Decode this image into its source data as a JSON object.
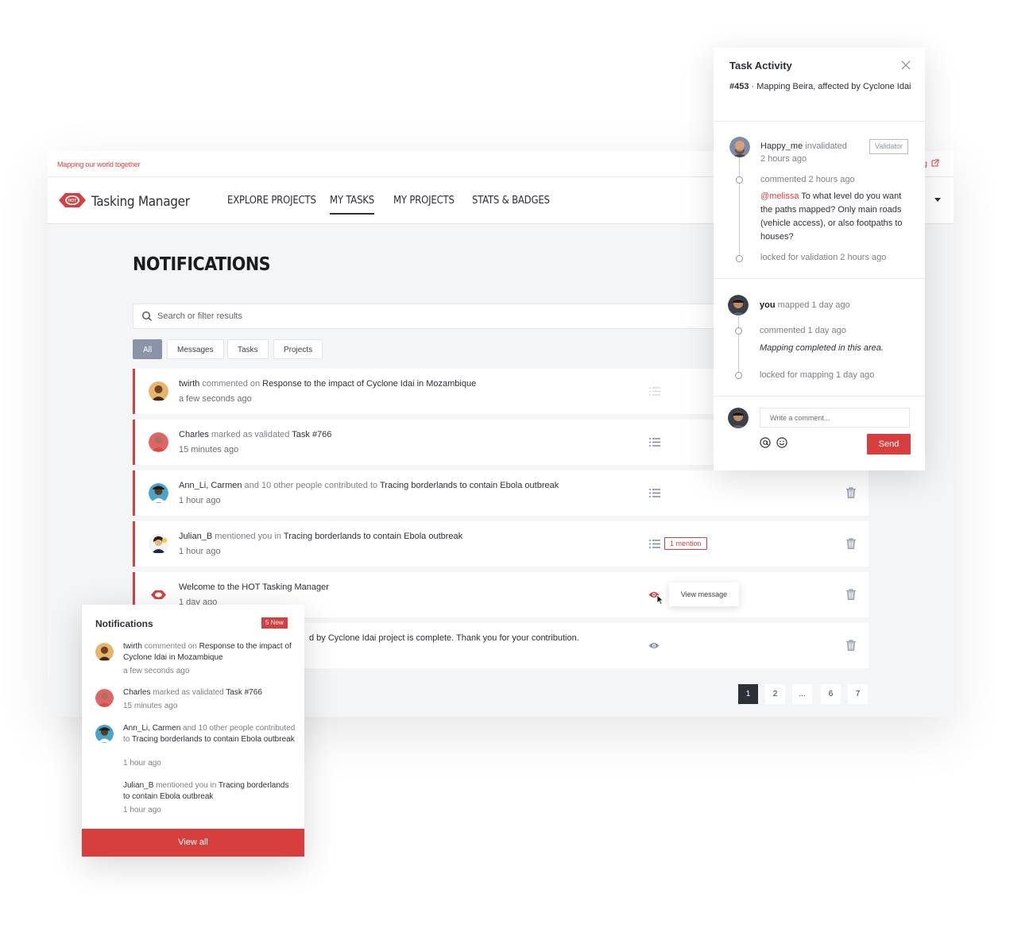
{
  "colors": {
    "accent": "#d73f3f",
    "dark": "#2c3038",
    "muted": "#7b7f86",
    "filter_active": "#8b93a6"
  },
  "topbar": {
    "tagline": "Mapping our world together",
    "org_link": "rg"
  },
  "nav": {
    "app_name": "Tasking Manager",
    "items": [
      "EXPLORE PROJECTS",
      "MY TASKS",
      "MY PROJECTS",
      "STATS & BADGES"
    ],
    "active": "MY TASKS"
  },
  "main": {
    "title": "NOTIFICATIONS",
    "search_placeholder": "Search or filter results",
    "filters": [
      "All",
      "Messages",
      "Tasks",
      "Projects"
    ],
    "active_filter": "All"
  },
  "notifications": [
    {
      "user": "twirth",
      "action": " commented on ",
      "target": "Response to the impact of Cyclone Idai in Mozambique",
      "time": "a few seconds ago"
    },
    {
      "user": "Charles",
      "action": " marked as validated ",
      "target": "Task #766",
      "time": "15 minutes ago"
    },
    {
      "user": "Ann_Li, Carmen",
      "action": " and 10 other people contributed to ",
      "target": "Tracing borderlands to contain Ebola outbreak",
      "time": "1 hour ago"
    },
    {
      "user": "Julian_B",
      "action": " mentioned you in ",
      "target": "Tracing borderlands to contain Ebola outbreak",
      "time": "1 hour ago",
      "badge": "1 mention"
    },
    {
      "user": "Welcome to the HOT Tasking Manager",
      "action": "",
      "target": "",
      "time": "1 day ago",
      "tooltip": "View message"
    },
    {
      "user": "d by Cyclone Idai project is complete. Thank you for your contribution.",
      "action": "",
      "target": "",
      "time": ""
    }
  ],
  "pagination": [
    "1",
    "2",
    "...",
    "6",
    "7"
  ],
  "activity": {
    "title": "Task Activity",
    "task_id": "#453",
    "task_name": " · Mapping Beira, affected by Cyclone Idai",
    "block1": {
      "user": "Happy_me",
      "action": " invalidated",
      "time": "2 hours ago",
      "role_badge": "Validator",
      "comment_meta": "commented 2 hours ago",
      "mention": "@melissa",
      "comment": " To what level do you want the paths mapped? Only main roads (vehicle access), or also footpaths to houses?",
      "lock": "locked for validation 2 hours ago"
    },
    "block2": {
      "user": "you",
      "action": " mapped 1 day ago",
      "comment_meta": "commented 1 day ago",
      "comment": "Mapping completed in this area.",
      "lock": "locked for mapping 1 day ago"
    },
    "comment_placeholder": "Write a comment...",
    "send": "Send"
  },
  "dropdown": {
    "title": "Notifications",
    "badge": "5 New",
    "items": [
      {
        "user": "twirth",
        "action": " commented on ",
        "target": "Response to the impact of Cyclone Idai in Mozambique",
        "time": "a few seconds ago"
      },
      {
        "user": "Charles",
        "action": " marked as validated ",
        "target": "Task #766",
        "time": "15 minutes ago"
      },
      {
        "user": "Ann_Li, Carmen",
        "action": "  and 10 other people contributed to ",
        "target": "Tracing borderlands to contain Ebola outbreak",
        "time": "1 hour ago"
      },
      {
        "user": "Julian_B",
        "action": " mentioned you in ",
        "target": "Tracing borderlands to contain Ebola outbreak",
        "time": "1 hour ago"
      }
    ],
    "view_all": "View all"
  }
}
